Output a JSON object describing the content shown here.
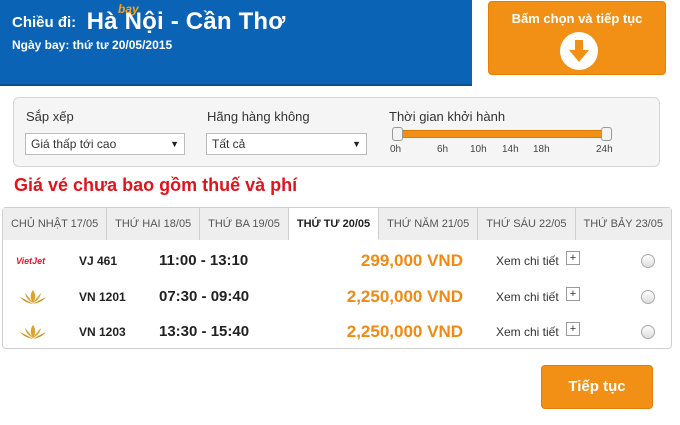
{
  "header": {
    "route_prefix": "Chiều đi:",
    "route": "Hà Nội - Cần Thơ",
    "bay_mark": "bay",
    "date_line": "Ngày bay: thứ tư 20/05/2015"
  },
  "top_button": {
    "label": "Bấm chọn và tiếp tục",
    "icon": "arrow-down-circle-icon"
  },
  "filters": {
    "sort": {
      "label": "Sắp xếp",
      "value": "Giá thấp tới cao"
    },
    "airline": {
      "label": "Hãng hàng không",
      "value": "Tất cả"
    },
    "time": {
      "label": "Thời gian khởi hành",
      "ticks": [
        "0h",
        "6h",
        "10h",
        "14h",
        "18h",
        "24h"
      ],
      "range": [
        0,
        24
      ]
    }
  },
  "notice": "Giá vé chưa bao gồm thuế và phí",
  "day_tabs": [
    {
      "label": "CHỦ NHẬT 17/05",
      "active": false
    },
    {
      "label": "THỨ HAI 18/05",
      "active": false
    },
    {
      "label": "THỨ BA 19/05",
      "active": false
    },
    {
      "label": "THỨ TƯ 20/05",
      "active": true
    },
    {
      "label": "THỨ NĂM 21/05",
      "active": false
    },
    {
      "label": "THỨ SÁU 22/05",
      "active": false
    },
    {
      "label": "THỨ BẢY 23/05",
      "active": false
    }
  ],
  "flights": [
    {
      "airline_logo": "vietjet",
      "logo_text": "VietJet",
      "code": "VJ 461",
      "time": "11:00 - 13:10",
      "price": "299,000 VND",
      "detail": "Xem chi tiết",
      "plus": "+"
    },
    {
      "airline_logo": "vietnam-airlines-lotus",
      "logo_text": "",
      "code": "VN 1201",
      "time": "07:30 - 09:40",
      "price": "2,250,000 VND",
      "detail": "Xem chi tiết",
      "plus": "+"
    },
    {
      "airline_logo": "vietnam-airlines-lotus",
      "logo_text": "",
      "code": "VN 1203",
      "time": "13:30 - 15:40",
      "price": "2,250,000 VND",
      "detail": "Xem chi tiết",
      "plus": "+"
    }
  ],
  "continue_button": {
    "label": "Tiếp tục"
  },
  "colors": {
    "header_blue": "#0b63b5",
    "accent_orange": "#f29016",
    "notice_red": "#e0141b",
    "price_orange": "#f08a14"
  }
}
